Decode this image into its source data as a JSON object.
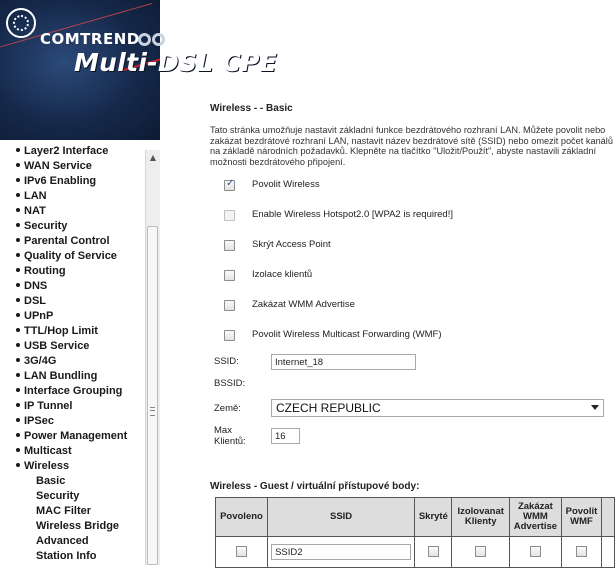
{
  "header": {
    "logo_text": "COMTREND",
    "product_title": "Multi-DSL CPE"
  },
  "nav": {
    "items": [
      {
        "label": "Layer2 Interface",
        "bullet": true
      },
      {
        "label": "WAN Service",
        "bullet": true
      },
      {
        "label": "IPv6 Enabling",
        "bullet": true
      },
      {
        "label": "LAN",
        "bullet": true
      },
      {
        "label": "NAT",
        "bullet": true
      },
      {
        "label": "Security",
        "bullet": true
      },
      {
        "label": "Parental Control",
        "bullet": true
      },
      {
        "label": "Quality of Service",
        "bullet": true
      },
      {
        "label": "Routing",
        "bullet": true
      },
      {
        "label": "DNS",
        "bullet": true
      },
      {
        "label": "DSL",
        "bullet": true
      },
      {
        "label": "UPnP",
        "bullet": true
      },
      {
        "label": "TTL/Hop Limit",
        "bullet": true
      },
      {
        "label": "USB Service",
        "bullet": true
      },
      {
        "label": "3G/4G",
        "bullet": true
      },
      {
        "label": "LAN Bundling",
        "bullet": true
      },
      {
        "label": "Interface Grouping",
        "bullet": true
      },
      {
        "label": "IP Tunnel",
        "bullet": true
      },
      {
        "label": "IPSec",
        "bullet": true
      },
      {
        "label": "Power Management",
        "bullet": true
      },
      {
        "label": "Multicast",
        "bullet": true
      },
      {
        "label": "Wireless",
        "bullet": true
      },
      {
        "label": "Basic",
        "bullet": false
      },
      {
        "label": "Security",
        "bullet": false
      },
      {
        "label": "MAC Filter",
        "bullet": false
      },
      {
        "label": "Wireless Bridge",
        "bullet": false
      },
      {
        "label": "Advanced",
        "bullet": false
      },
      {
        "label": "Station Info",
        "bullet": false
      }
    ]
  },
  "page": {
    "title": "Wireless - - Basic",
    "description": "Tato stránka umožňuje nastavit základní funkce bezdrátového rozhraní LAN. Můžete povolit nebo zakázat bezdrátové rozhraní LAN, nastavit název bezdrátové sítě (SSID) nebo omezit počet kanálů na základě národních požadavků. Klepněte na tlačítko \"Uložit/Použít\", abyste nastavili základní možnosti bezdrátového připojení."
  },
  "options": [
    {
      "label": "Povolit Wireless",
      "checked": true,
      "disabled": false
    },
    {
      "label": "Enable Wireless Hotspot2.0 [WPA2 is required!]",
      "checked": false,
      "disabled": true
    },
    {
      "label": "Skrýt Access Point",
      "checked": false,
      "disabled": false
    },
    {
      "label": "Izolace klientů",
      "checked": false,
      "disabled": false
    },
    {
      "label": "Zakázat WMM Advertise",
      "checked": false,
      "disabled": false
    },
    {
      "label": "Povolit Wireless Multicast Forwarding (WMF)",
      "checked": false,
      "disabled": false
    }
  ],
  "fields": {
    "ssid_label": "SSID:",
    "ssid_value": "Internet_18",
    "bssid_label": "BSSID:",
    "bssid_value": "",
    "country_label": "Země:",
    "country_value": "CZECH REPUBLIC",
    "max_clients_label_line1": "Max",
    "max_clients_label_line2": "Klientů:",
    "max_clients_value": "16"
  },
  "guest": {
    "title": "Wireless - Guest / virtuální přístupové body:",
    "headers": {
      "enabled": "Povoleno",
      "ssid": "SSID",
      "hidden": "Skryté",
      "isolate_1": "Izolovanat",
      "isolate_2": "Klienty",
      "wmm_1": "Zakázat",
      "wmm_2": "WMM",
      "wmm_3": "Advertise",
      "wmf_1": "Povolit",
      "wmf_2": "WMF"
    },
    "rows": [
      {
        "ssid": "SSID2"
      }
    ]
  }
}
